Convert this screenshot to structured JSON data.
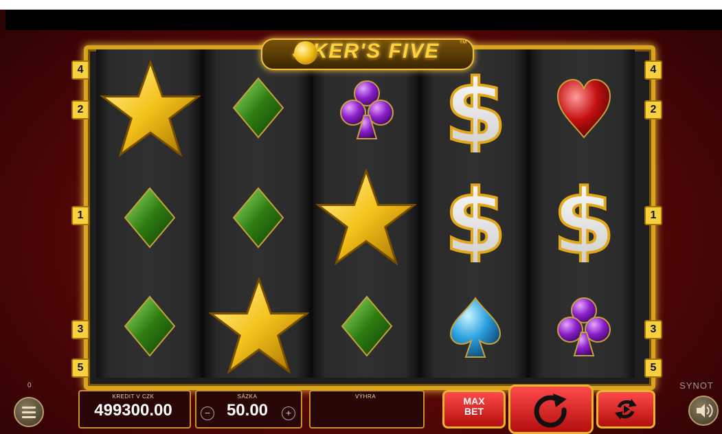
{
  "game": {
    "title": "J   KER'S FIVE",
    "trademark": "™",
    "provider": "SYNOT"
  },
  "paylines": {
    "left": [
      "4",
      "2",
      "1",
      "3",
      "5"
    ],
    "right": [
      "4",
      "2",
      "1",
      "3",
      "5"
    ]
  },
  "reels": [
    [
      "star",
      "diamond",
      "diamond"
    ],
    [
      "diamond",
      "diamond",
      "star"
    ],
    [
      "club",
      "star",
      "diamond"
    ],
    [
      "dollar",
      "dollar",
      "spade"
    ],
    [
      "heart",
      "dollar",
      "club"
    ]
  ],
  "colors": {
    "frame_gold": "#d9a520",
    "background_red": "#8f1010",
    "spin_red": "#d41a1a"
  },
  "controls": {
    "menu_counter": "0",
    "credit_label": "KREDIT V CZK",
    "credit_value": "499300.00",
    "bet_label": "SÁZKA",
    "bet_value": "50.00",
    "bet_minus": "−",
    "bet_plus": "+",
    "win_label": "VÝHRA",
    "win_value": "",
    "maxbet_line1": "MAX",
    "maxbet_line2": "BET",
    "menu_icon": "hamburger-icon",
    "spin_icon": "spin-arrow-icon",
    "autoplay_icon": "autoplay-icon",
    "sound_icon": "speaker-icon"
  }
}
